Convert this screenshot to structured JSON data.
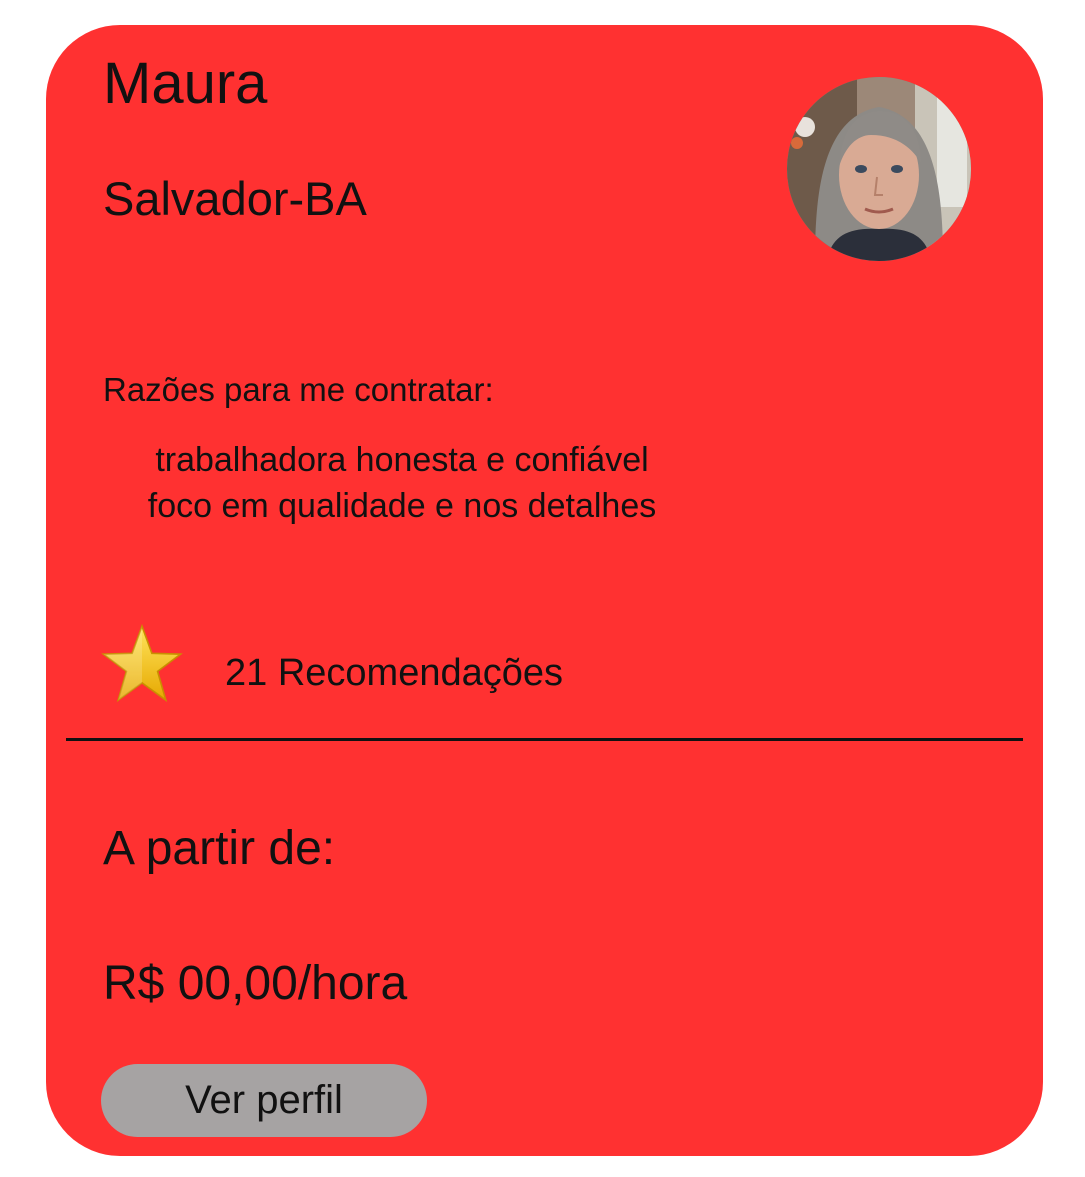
{
  "profile": {
    "name": "Maura",
    "location": "Salvador-BA",
    "avatar_icon": "person-photo"
  },
  "reasons": {
    "title": "Razões para me contratar:",
    "items": [
      "trabalhadora honesta e confiável",
      "foco em qualidade e nos detalhes"
    ]
  },
  "rating": {
    "icon": "star-icon",
    "recommendations_text": "21 Recomendações"
  },
  "pricing": {
    "label": "A partir de:",
    "price": "R$ 00,00/hora"
  },
  "actions": {
    "view_profile_label": "Ver perfil"
  },
  "colors": {
    "card_background": "#ff3131",
    "button_background": "#a6a3a3",
    "text": "#111111",
    "star": "#f5c518"
  }
}
